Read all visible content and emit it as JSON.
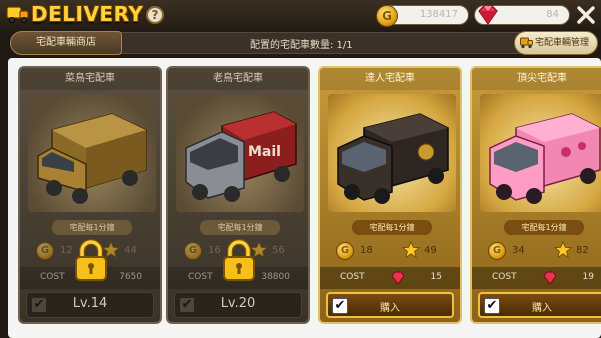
{
  "header": {
    "title": "DELIVERY",
    "help_label": "?",
    "coins": "138417",
    "gems": "84",
    "close_label": "close"
  },
  "subbar": {
    "shop_tab": "宅配車輛商店",
    "count_text": "配置的宅配車數量: 1/1",
    "manage_button": "宅配車輛管理"
  },
  "cards": [
    {
      "name": "菜鳥宅配車",
      "rate": "宅配每1分鐘",
      "coin_stat": "12",
      "star_stat": "44",
      "cost_label": "COST",
      "cost": "7650",
      "locked": true,
      "action": "Lv.14",
      "color": "#b38a2e"
    },
    {
      "name": "老鳥宅配車",
      "rate": "宅配每1分鐘",
      "coin_stat": "16",
      "star_stat": "56",
      "cost_label": "COST",
      "cost": "38800",
      "locked": true,
      "action": "Lv.20",
      "color": "#a32424"
    },
    {
      "name": "達人宅配車",
      "rate": "宅配每1分鐘",
      "coin_stat": "18",
      "star_stat": "49",
      "cost_label": "COST",
      "cost": "15",
      "locked": false,
      "action": "購入",
      "color": "#3a2a22"
    },
    {
      "name": "頂尖宅配車",
      "rate": "宅配每1分鐘",
      "coin_stat": "34",
      "star_stat": "82",
      "cost_label": "COST",
      "cost": "19",
      "locked": false,
      "action": "購入",
      "color": "#f07aa8"
    }
  ],
  "icons": {
    "coin": "G",
    "check": "✔"
  }
}
